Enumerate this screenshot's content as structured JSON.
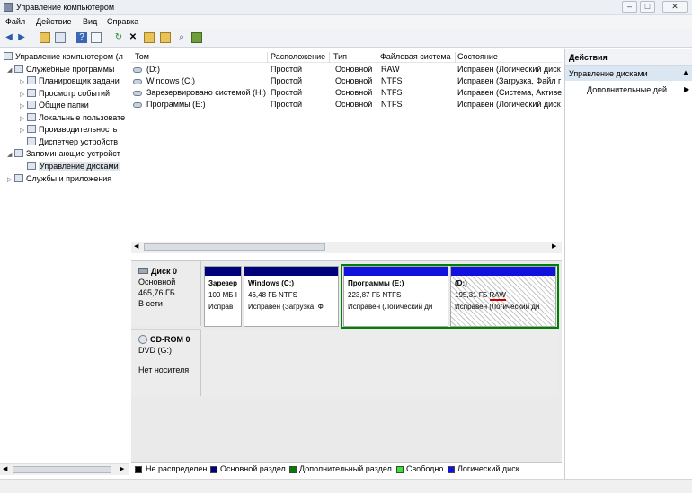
{
  "window": {
    "title": "Управление компьютером",
    "min": "–",
    "max": "□",
    "close": "✕"
  },
  "menu": [
    "Файл",
    "Действие",
    "Вид",
    "Справка"
  ],
  "toolbar_icons": [
    "back-icon",
    "forward-icon",
    "up-folder-icon",
    "show-tree-icon",
    "help-icon",
    "properties-icon",
    "refresh-icon",
    "delete-icon",
    "open-icon",
    "folder-icon",
    "search-icon",
    "export-icon"
  ],
  "tree": [
    {
      "label": "Управление компьютером (л",
      "exp": ""
    },
    {
      "label": "Служебные программы",
      "exp": "◢"
    },
    {
      "label": "Планировщик задани",
      "exp": "▷"
    },
    {
      "label": "Просмотр событий",
      "exp": "▷"
    },
    {
      "label": "Общие папки",
      "exp": "▷"
    },
    {
      "label": "Локальные пользовате",
      "exp": "▷"
    },
    {
      "label": "Производительность",
      "exp": "▷"
    },
    {
      "label": "Диспетчер устройств",
      "exp": ""
    },
    {
      "label": "Запоминающие устройст",
      "exp": "◢"
    },
    {
      "label": "Управление дисками",
      "exp": ""
    },
    {
      "label": "Службы и приложения",
      "exp": "▷"
    }
  ],
  "volumes": {
    "columns": [
      "Том",
      "Расположение",
      "Тип",
      "Файловая система",
      "Состояние"
    ],
    "rows": [
      [
        "(D:)",
        "Простой",
        "Основной",
        "RAW",
        "Исправен (Логический диск"
      ],
      [
        "Windows (C:)",
        "Простой",
        "Основной",
        "NTFS",
        "Исправен (Загрузка, Файл г"
      ],
      [
        "Зарезервировано системой (H:)",
        "Простой",
        "Основной",
        "NTFS",
        "Исправен (Система, Активе"
      ],
      [
        "Программы (E:)",
        "Простой",
        "Основной",
        "NTFS",
        "Исправен (Логический диск"
      ]
    ]
  },
  "disks": [
    {
      "name": "Диск 0",
      "type": "Основной",
      "size": "465,76 ГБ",
      "status": "В сети",
      "partitions": [
        {
          "name": "Зарезер",
          "size": "100 МБ I",
          "status": "Исправ"
        },
        {
          "name": "Windows  (C:)",
          "size": "46,48 ГБ NTFS",
          "status": "Исправен (Загрузка, Ф"
        },
        {
          "name": "Программы  (E:)",
          "size": "223,87 ГБ NTFS",
          "status": "Исправен (Логический ди"
        },
        {
          "name": "(D:)",
          "size": "195,31 ГБ",
          "fs": "RAW",
          "status": "Исправен (Логический ди"
        }
      ]
    },
    {
      "name": "CD-ROM 0",
      "type": "DVD (G:)",
      "status": "Нет носителя"
    }
  ],
  "legend": [
    {
      "label": "Не распределен",
      "color": "#000000"
    },
    {
      "label": "Основной раздел",
      "color": "#00007a"
    },
    {
      "label": "Дополнительный раздел",
      "color": "#008000"
    },
    {
      "label": "Свободно",
      "color": "#33e833"
    },
    {
      "label": "Логический диск",
      "color": "#1111dd"
    }
  ],
  "actions": {
    "title": "Действия",
    "section": "Управление дисками",
    "more": "Дополнительные дей..."
  }
}
